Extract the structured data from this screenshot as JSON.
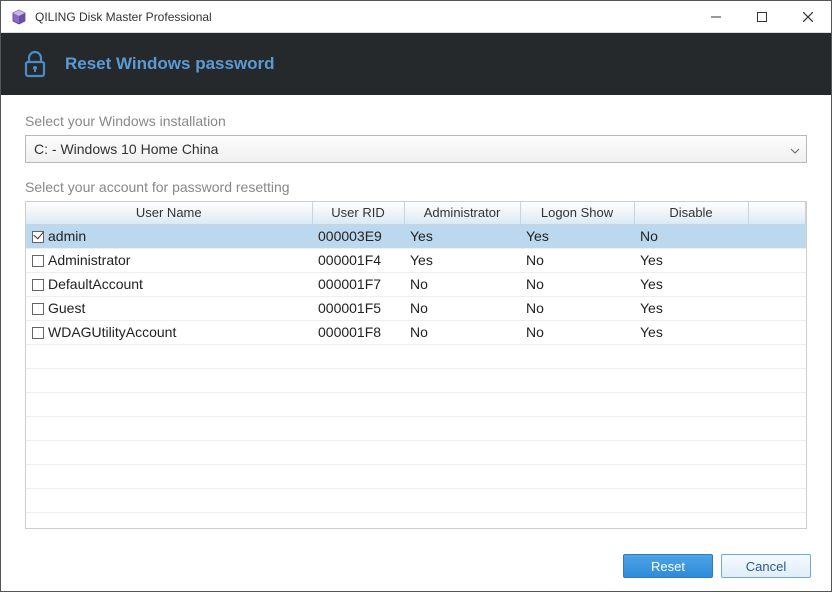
{
  "window": {
    "title": "QILING Disk Master Professional"
  },
  "banner": {
    "title": "Reset Windows password"
  },
  "labels": {
    "select_install": "Select your Windows installation",
    "select_account": "Select your account for password resetting"
  },
  "dropdown": {
    "selected": "C: - Windows 10 Home China"
  },
  "table": {
    "headers": {
      "name": "User Name",
      "rid": "User RID",
      "admin": "Administrator",
      "logon": "Logon Show",
      "disable": "Disable"
    },
    "rows": [
      {
        "checked": true,
        "name": "admin",
        "rid": "000003E9",
        "admin": "Yes",
        "logon": "Yes",
        "disable": "No",
        "selected": true
      },
      {
        "checked": false,
        "name": "Administrator",
        "rid": "000001F4",
        "admin": "Yes",
        "logon": "No",
        "disable": "Yes",
        "selected": false
      },
      {
        "checked": false,
        "name": "DefaultAccount",
        "rid": "000001F7",
        "admin": "No",
        "logon": "No",
        "disable": "Yes",
        "selected": false
      },
      {
        "checked": false,
        "name": "Guest",
        "rid": "000001F5",
        "admin": "No",
        "logon": "No",
        "disable": "Yes",
        "selected": false
      },
      {
        "checked": false,
        "name": "WDAGUtilityAccount",
        "rid": "000001F8",
        "admin": "No",
        "logon": "No",
        "disable": "Yes",
        "selected": false
      }
    ]
  },
  "buttons": {
    "reset": "Reset",
    "cancel": "Cancel"
  }
}
